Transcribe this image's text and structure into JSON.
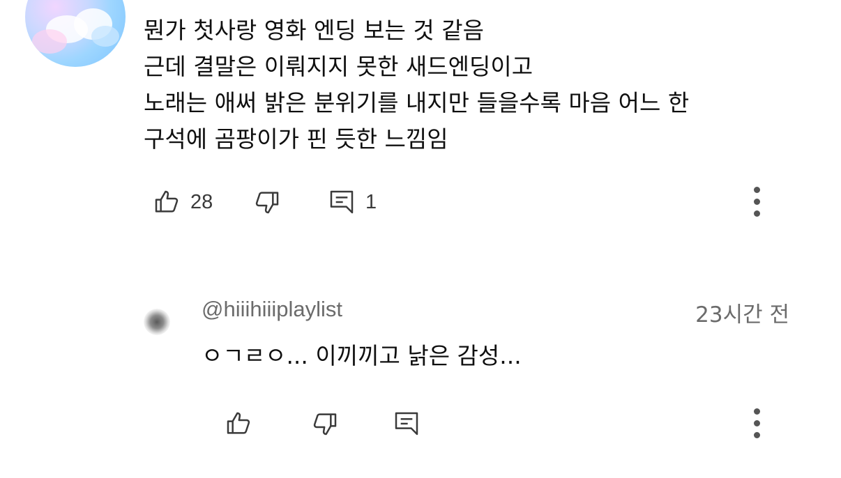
{
  "comment": {
    "lines": [
      "뭔가 첫사랑 영화 엔딩 보는 것 같음",
      "근데 결말은 이뤄지지 못한 새드엔딩이고",
      "노래는 애써 밝은 분위기를 내지만 들을수록 마음 어느 한",
      "구석에 곰팡이가 핀 듯한 느낌임"
    ],
    "like_count": "28",
    "reply_count": "1",
    "icons": {
      "like": "thumbs-up-icon",
      "dislike": "thumbs-down-icon",
      "reply": "comment-icon",
      "more": "more-vert-icon"
    }
  },
  "reply": {
    "handle": "@hiiihiiiplaylist",
    "time": "23시간 전",
    "text": "ㅇㄱㄹㅇ... 이끼끼고 낡은 감성..."
  }
}
